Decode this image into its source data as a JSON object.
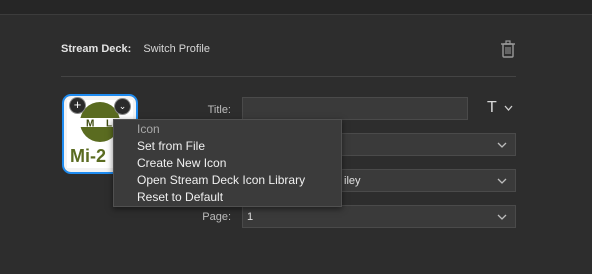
{
  "header": {
    "plugin": "Stream Deck:",
    "action": "Switch Profile"
  },
  "icon_badge": {
    "add": "+",
    "menu": "⌄"
  },
  "icon_preview": {
    "label": "Mi-2"
  },
  "fields": {
    "title_label": "Title:",
    "title_value": "",
    "device_value": "",
    "profile_value": "iley",
    "page_label": "Page:",
    "page_value": "1"
  },
  "title_button": {
    "glyph": "T"
  },
  "context_menu": {
    "header": "Icon",
    "items": [
      "Set from File",
      "Create New Icon",
      "Open Stream Deck Icon Library",
      "Reset to Default"
    ]
  }
}
